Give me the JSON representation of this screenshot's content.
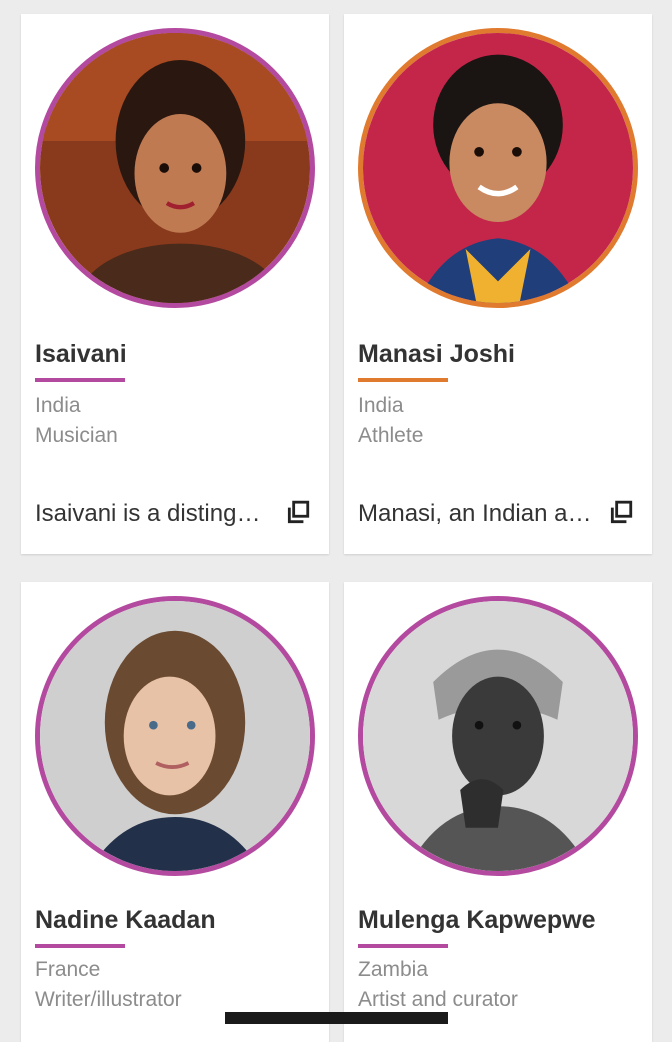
{
  "cards": [
    {
      "name": "Isaivani",
      "country": "India",
      "role": "Musician",
      "description": "Isaivani is a distinguished musician",
      "accent": "#b44a9f"
    },
    {
      "name": "Manasi Joshi",
      "country": "India",
      "role": "Athlete",
      "description": "Manasi, an Indian athlete",
      "accent": "#e07a2e"
    },
    {
      "name": "Nadine Kaadan",
      "country": "France",
      "role": "Writer/illustrator",
      "accent": "#b44a9f"
    },
    {
      "name": "Mulenga Kapwepwe",
      "country": "Zambia",
      "role": "Artist and curator",
      "accent": "#b44a9f"
    }
  ],
  "icons": {
    "open": "open-in-new-icon"
  }
}
